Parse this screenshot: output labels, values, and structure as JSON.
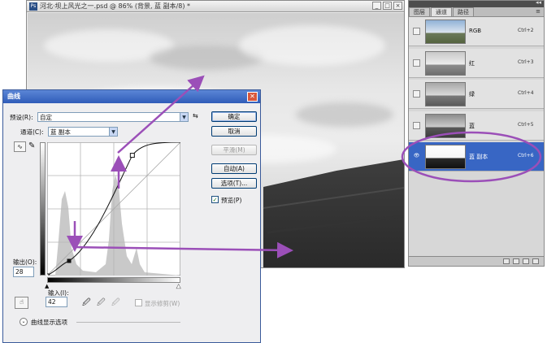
{
  "document": {
    "title": "河北·坝上风光之一.psd @ 86% (背景, 蓝 副本/8) *",
    "app_icon": "Ps",
    "controls": [
      "_",
      "□",
      "×"
    ]
  },
  "panel": {
    "tabs": [
      "图层",
      "通道",
      "路径"
    ],
    "active_tab": 1,
    "menu_icon": "≡",
    "channels": [
      {
        "name": "RGB",
        "shortcut": "Ctrl+2",
        "tone": "color",
        "visible": false
      },
      {
        "name": "红",
        "shortcut": "Ctrl+3",
        "tone": "light",
        "visible": false
      },
      {
        "name": "绿",
        "shortcut": "Ctrl+4",
        "tone": "mid",
        "visible": false
      },
      {
        "name": "蓝",
        "shortcut": "Ctrl+5",
        "tone": "dark",
        "visible": false
      },
      {
        "name": "蓝 副本",
        "shortcut": "Ctrl+6",
        "tone": "contrast",
        "visible": true,
        "selected": true
      }
    ]
  },
  "curves": {
    "title": "曲线",
    "preset_label": "预设(R):",
    "preset_value": "自定",
    "channel_label": "通道(C):",
    "channel_value": "蓝 副本",
    "buttons": {
      "ok": "确定",
      "cancel": "取消",
      "smooth": "平滑(M)",
      "auto": "自动(A)",
      "options": "选项(T)..."
    },
    "preview_label": "预览(P)",
    "preview_checked": true,
    "output_label": "输出(O):",
    "output_value": "28",
    "input_label": "输入(I):",
    "input_value": "42",
    "show_clipping_label": "显示修剪(W)",
    "curve_options_label": "曲线显示选项",
    "point_low": {
      "input": 42,
      "output": 28
    },
    "point_high": {
      "input": 163,
      "output": 230
    }
  },
  "colors": {
    "accent": "#3866c4",
    "annotation": "#9b4fb8",
    "dialog_title": "#2f5cb9"
  }
}
